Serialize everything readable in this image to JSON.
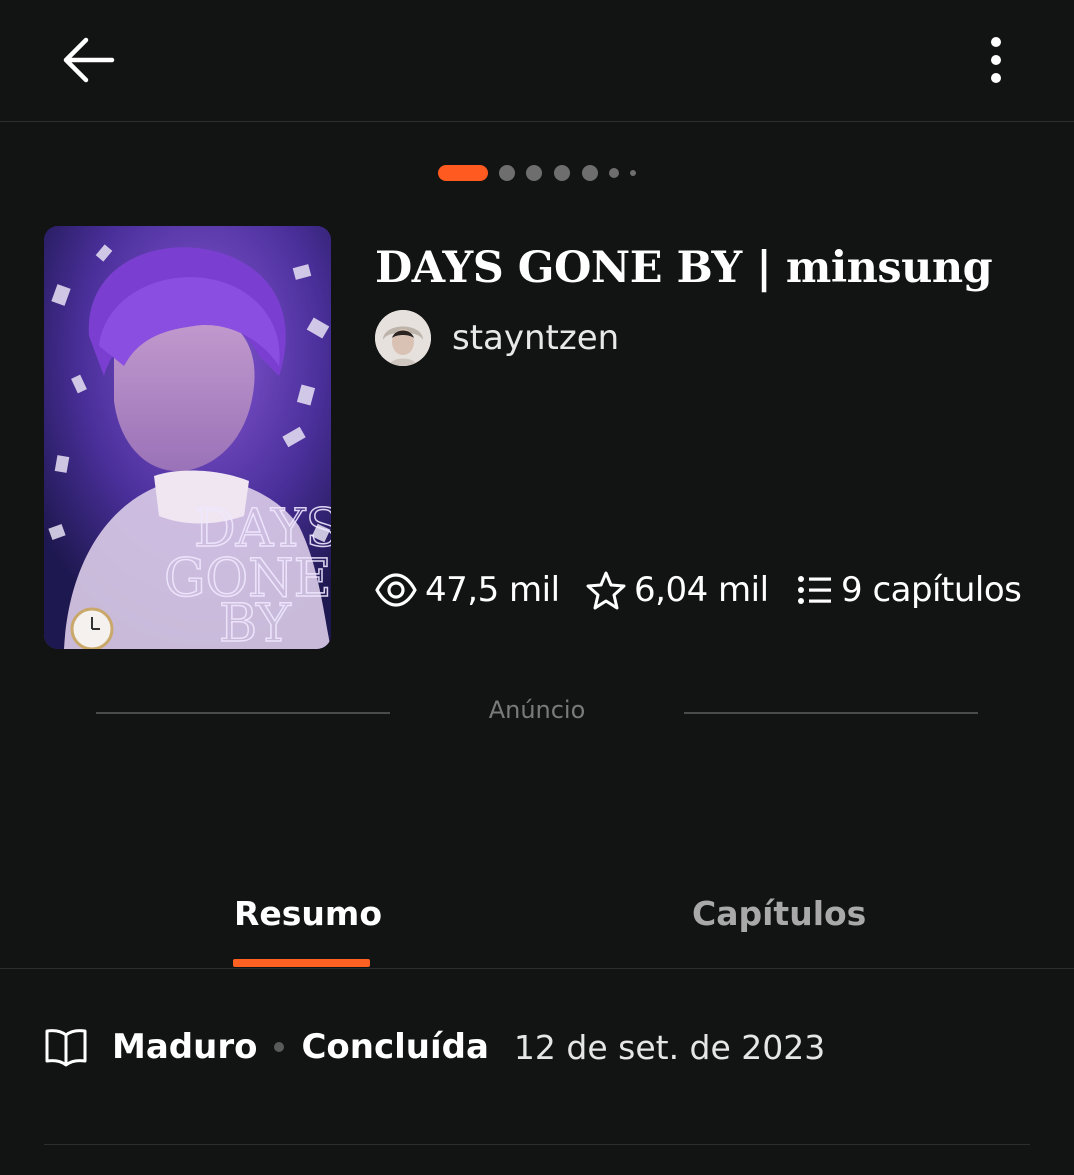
{
  "header": {
    "back_icon": "arrow-left-icon",
    "menu_icon": "more-vertical-icon"
  },
  "carousel": {
    "total_dots": 7,
    "active_index": 0,
    "accent_color": "#ff6122"
  },
  "story": {
    "title": "DAYS GONE BY | minsung",
    "author": "stayntzen",
    "cover_text": "DAYS GONE BY",
    "stats": {
      "views": "47,5 mil",
      "votes": "6,04 mil",
      "chapters": "9 capítulos"
    }
  },
  "ad": {
    "label": "Anúncio"
  },
  "tabs": {
    "summary": "Resumo",
    "chapters": "Capítulos",
    "active": "summary"
  },
  "details": {
    "rating": "Maduro",
    "status": "Concluída",
    "date": "12 de set. de 2023"
  },
  "colors": {
    "background": "#121313",
    "accent": "#ff6122",
    "divider": "#2c2d2d"
  }
}
